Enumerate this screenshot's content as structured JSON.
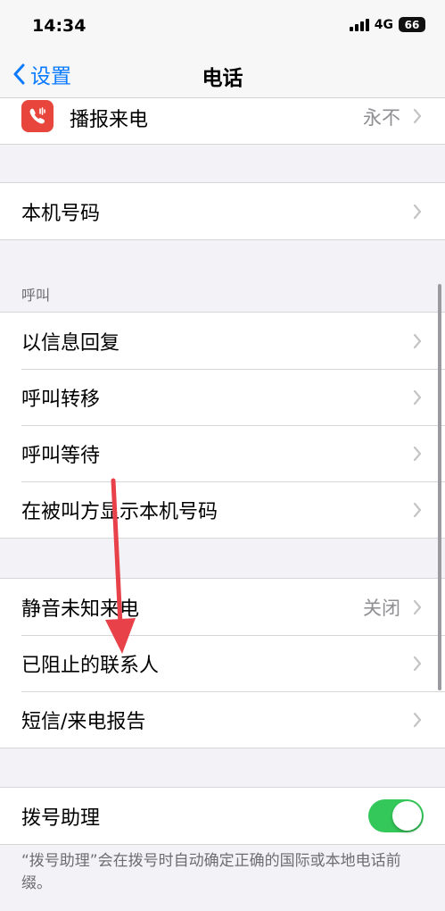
{
  "status_bar": {
    "time": "14:34",
    "network": "4G",
    "battery": "66"
  },
  "nav": {
    "back_label": "设置",
    "title": "电话"
  },
  "group_top": {
    "announce_calls": {
      "label": "播报来电",
      "value": "永不"
    }
  },
  "group_number": {
    "my_number": {
      "label": "本机号码"
    }
  },
  "section_calls": {
    "header": "呼叫",
    "items": [
      {
        "label": "以信息回复"
      },
      {
        "label": "呼叫转移"
      },
      {
        "label": "呼叫等待"
      },
      {
        "label": "在被叫方显示本机号码"
      }
    ]
  },
  "group_silence": {
    "silence_unknown": {
      "label": "静音未知来电",
      "value": "关闭"
    },
    "blocked_contacts": {
      "label": "已阻止的联系人"
    },
    "sms_call_reporting": {
      "label": "短信/来电报告"
    }
  },
  "group_dial": {
    "dial_assist": {
      "label": "拨号助理",
      "enabled": true
    }
  },
  "footer": {
    "dial_assist_note": "“拨号助理”会在拨号时自动确定正确的国际或本地电话前缀。"
  },
  "colors": {
    "accent": "#0a7aff",
    "toggle_on": "#34c759",
    "annotation_arrow": "#e8414a",
    "app_icon_bg": "#e8453c"
  },
  "icons": {
    "back": "chevron-left-icon",
    "row_arrow": "chevron-right-icon",
    "announce": "phone-sound-icon"
  }
}
